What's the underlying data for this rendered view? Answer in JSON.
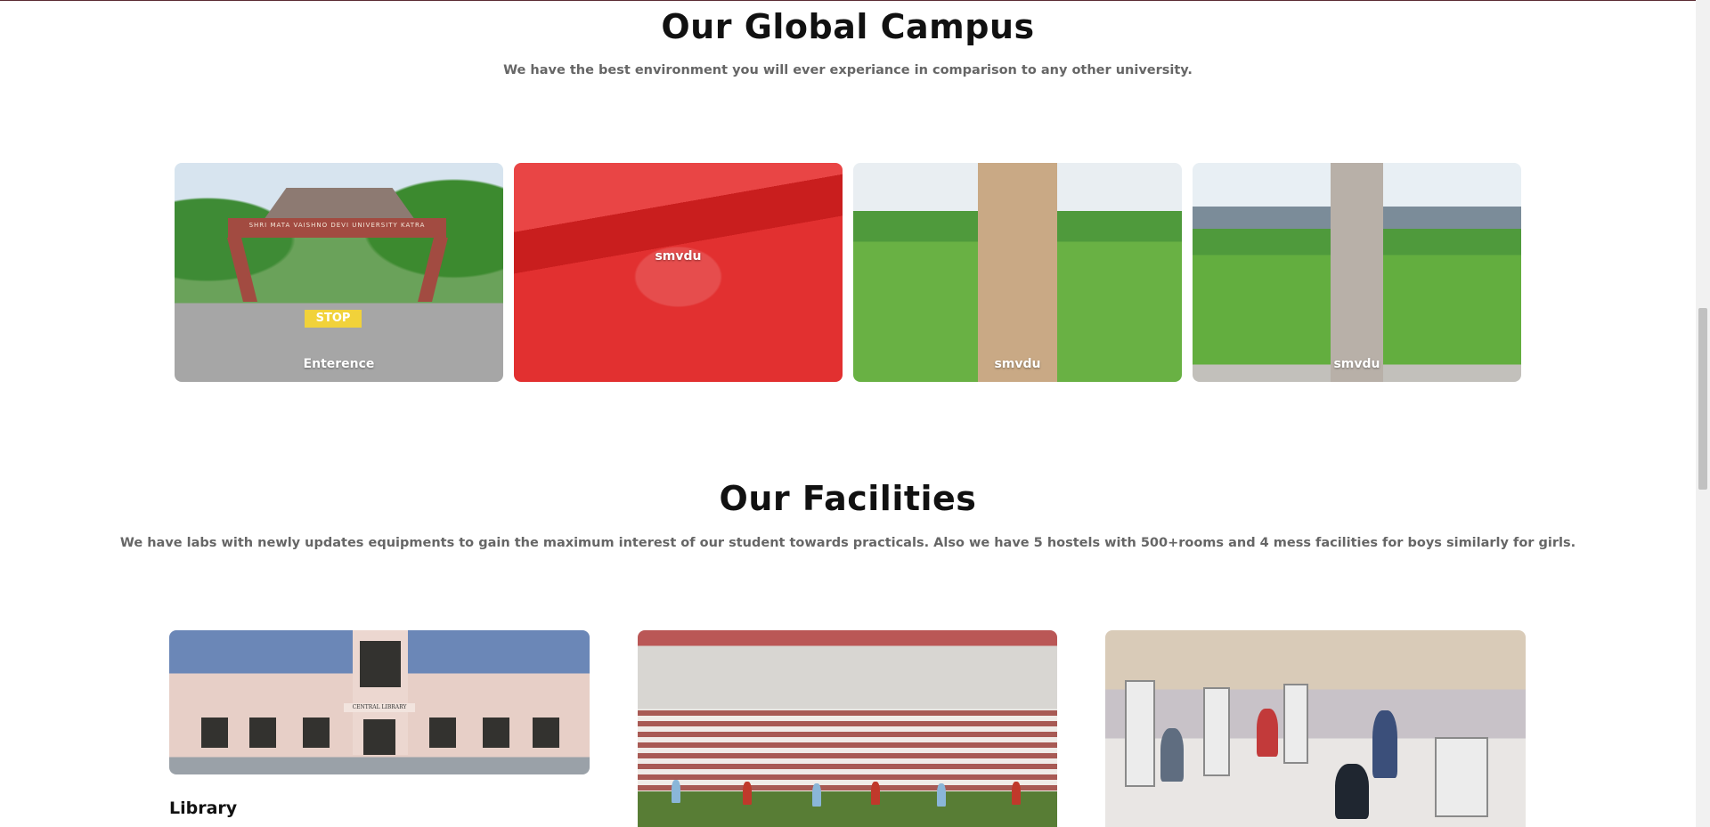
{
  "campus": {
    "title": "Our Global Campus",
    "subtitle": "We have the best environment you will ever experiance in comparison to any other university.",
    "gallery": [
      {
        "caption": "Enterence",
        "photo": "university-entrance-gate"
      },
      {
        "caption": "smvdu",
        "photo": "campus-hill-view",
        "state": "hovered",
        "overlay_color": "#e52b2b"
      },
      {
        "caption": "smvdu",
        "photo": "campus-garden-path"
      },
      {
        "caption": "smvdu",
        "photo": "campus-lawn-walkway"
      }
    ],
    "arch_text": "SHRI MATA VAISHNO DEVI UNIVERSITY KATRA",
    "stop_text": "STOP"
  },
  "facilities": {
    "title": "Our Facilities",
    "subtitle": "We have labs with newly updates equipments to gain the maximum interest of our student towards practicals. Also we have 5 hostels with 500+rooms and 4 mess facilities for boys similarly for girls.",
    "items": [
      {
        "label": "Library",
        "photo": "central-library-building",
        "sign": "CENTRAL LIBRARY"
      },
      {
        "label": "",
        "photo": "stadium-football-match"
      },
      {
        "label": "",
        "photo": "gym-fitness-center"
      }
    ]
  },
  "colors": {
    "heading": "#111111",
    "subtext": "#666666",
    "accent_red": "#e52b2b",
    "top_rule": "#5b2b33"
  }
}
